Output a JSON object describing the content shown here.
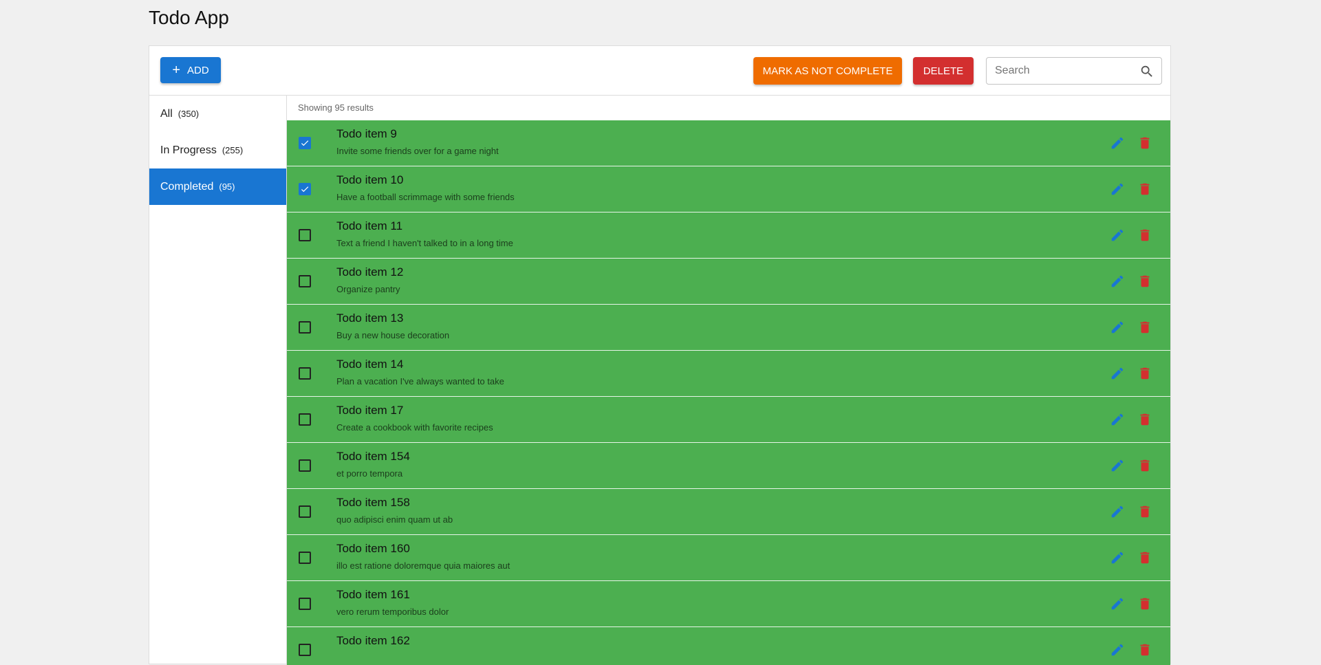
{
  "app": {
    "title": "Todo App"
  },
  "toolbar": {
    "add_label": "ADD",
    "mark_not_complete_label": "MARK AS NOT COMPLETE",
    "delete_label": "DELETE",
    "search_placeholder": "Search",
    "search_value": ""
  },
  "colors": {
    "primary": "#1976d2",
    "warning": "#ef6c00",
    "danger": "#d32f2f",
    "completed_row": "#4caf50"
  },
  "filters": [
    {
      "label": "All",
      "count": "(350)",
      "active": false
    },
    {
      "label": "In Progress",
      "count": "(255)",
      "active": false
    },
    {
      "label": "Completed",
      "count": "(95)",
      "active": true
    }
  ],
  "results": {
    "text": "Showing 95 results"
  },
  "todos": [
    {
      "title": "Todo item 9",
      "description": "Invite some friends over for a game night",
      "checked": true
    },
    {
      "title": "Todo item 10",
      "description": "Have a football scrimmage with some friends",
      "checked": true
    },
    {
      "title": "Todo item 11",
      "description": "Text a friend I haven't talked to in a long time",
      "checked": false
    },
    {
      "title": "Todo item 12",
      "description": "Organize pantry",
      "checked": false
    },
    {
      "title": "Todo item 13",
      "description": "Buy a new house decoration",
      "checked": false
    },
    {
      "title": "Todo item 14",
      "description": "Plan a vacation I've always wanted to take",
      "checked": false
    },
    {
      "title": "Todo item 17",
      "description": "Create a cookbook with favorite recipes",
      "checked": false
    },
    {
      "title": "Todo item 154",
      "description": "et porro tempora",
      "checked": false
    },
    {
      "title": "Todo item 158",
      "description": "quo adipisci enim quam ut ab",
      "checked": false
    },
    {
      "title": "Todo item 160",
      "description": "illo est ratione doloremque quia maiores aut",
      "checked": false
    },
    {
      "title": "Todo item 161",
      "description": "vero rerum temporibus dolor",
      "checked": false
    },
    {
      "title": "Todo item 162",
      "description": "",
      "checked": false
    }
  ],
  "icons": {
    "add": "plus-icon",
    "search": "search-icon",
    "edit": "pencil-icon",
    "delete": "trash-icon",
    "check": "check-icon"
  }
}
